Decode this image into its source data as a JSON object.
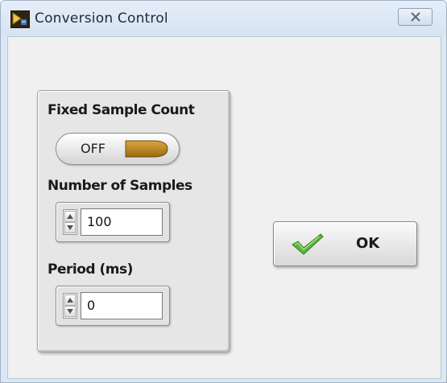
{
  "window": {
    "title": "Conversion Control",
    "app_icon": "labview-vi-icon",
    "close_icon": "close-icon"
  },
  "controls": {
    "fixed_sample_count": {
      "label": "Fixed Sample Count",
      "state_text": "OFF",
      "state": false,
      "knob_color": "#b07d1a"
    },
    "number_of_samples": {
      "label": "Number of Samples",
      "value": "100"
    },
    "period": {
      "label": "Period (ms)",
      "value": "0"
    }
  },
  "ok_button": {
    "label": "OK",
    "icon": "checkmark-icon",
    "icon_color": "#4aa02c"
  },
  "colors": {
    "window_background": "#f0f0f0",
    "title_bar": "#dce7f3"
  }
}
